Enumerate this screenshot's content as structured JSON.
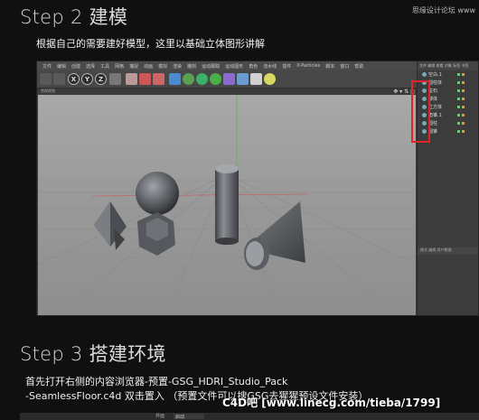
{
  "watermark_top": "思缘设计论坛 www",
  "step2": {
    "title": "Step 2  建模",
    "desc": "根据自己的需要建好模型，这里以基础立体图形讲解"
  },
  "step3": {
    "title": "Step 3  搭建环境",
    "line1": "首先打开右侧的内容浏览器-预置-GSG_HDRI_Studio_Pack",
    "line2": "-SeamlessFloor.c4d 双击置入  （预置文件可以搜GSG去猩猩预设文件安装）"
  },
  "c4d": {
    "menu": [
      "文件",
      "编辑",
      "创建",
      "选择",
      "工具",
      "网格",
      "捕捉",
      "动画",
      "模拟",
      "渲染",
      "雕刻",
      "运动跟踪",
      "运动图形",
      "角色",
      "流水线",
      "插件",
      "X-Particles",
      "脚本",
      "窗口",
      "帮助"
    ],
    "toolbar_letters": [
      "X",
      "Y",
      "Z"
    ],
    "view_label": "透视视图",
    "object_manager": {
      "header": "文件 编辑 查看 对象 标签 书签",
      "items": [
        "空白.1",
        "圆柱体",
        "宝石",
        "球体",
        "立方体",
        "角锥.1",
        "圆柱",
        "圆锥"
      ],
      "attr_tab": "模式 编辑 用户数据"
    }
  },
  "watermark_logo": "C4D吧  [www.linecg.com/tieba/1799]",
  "bottom_bar": {
    "left": "界面",
    "right": "启动"
  }
}
